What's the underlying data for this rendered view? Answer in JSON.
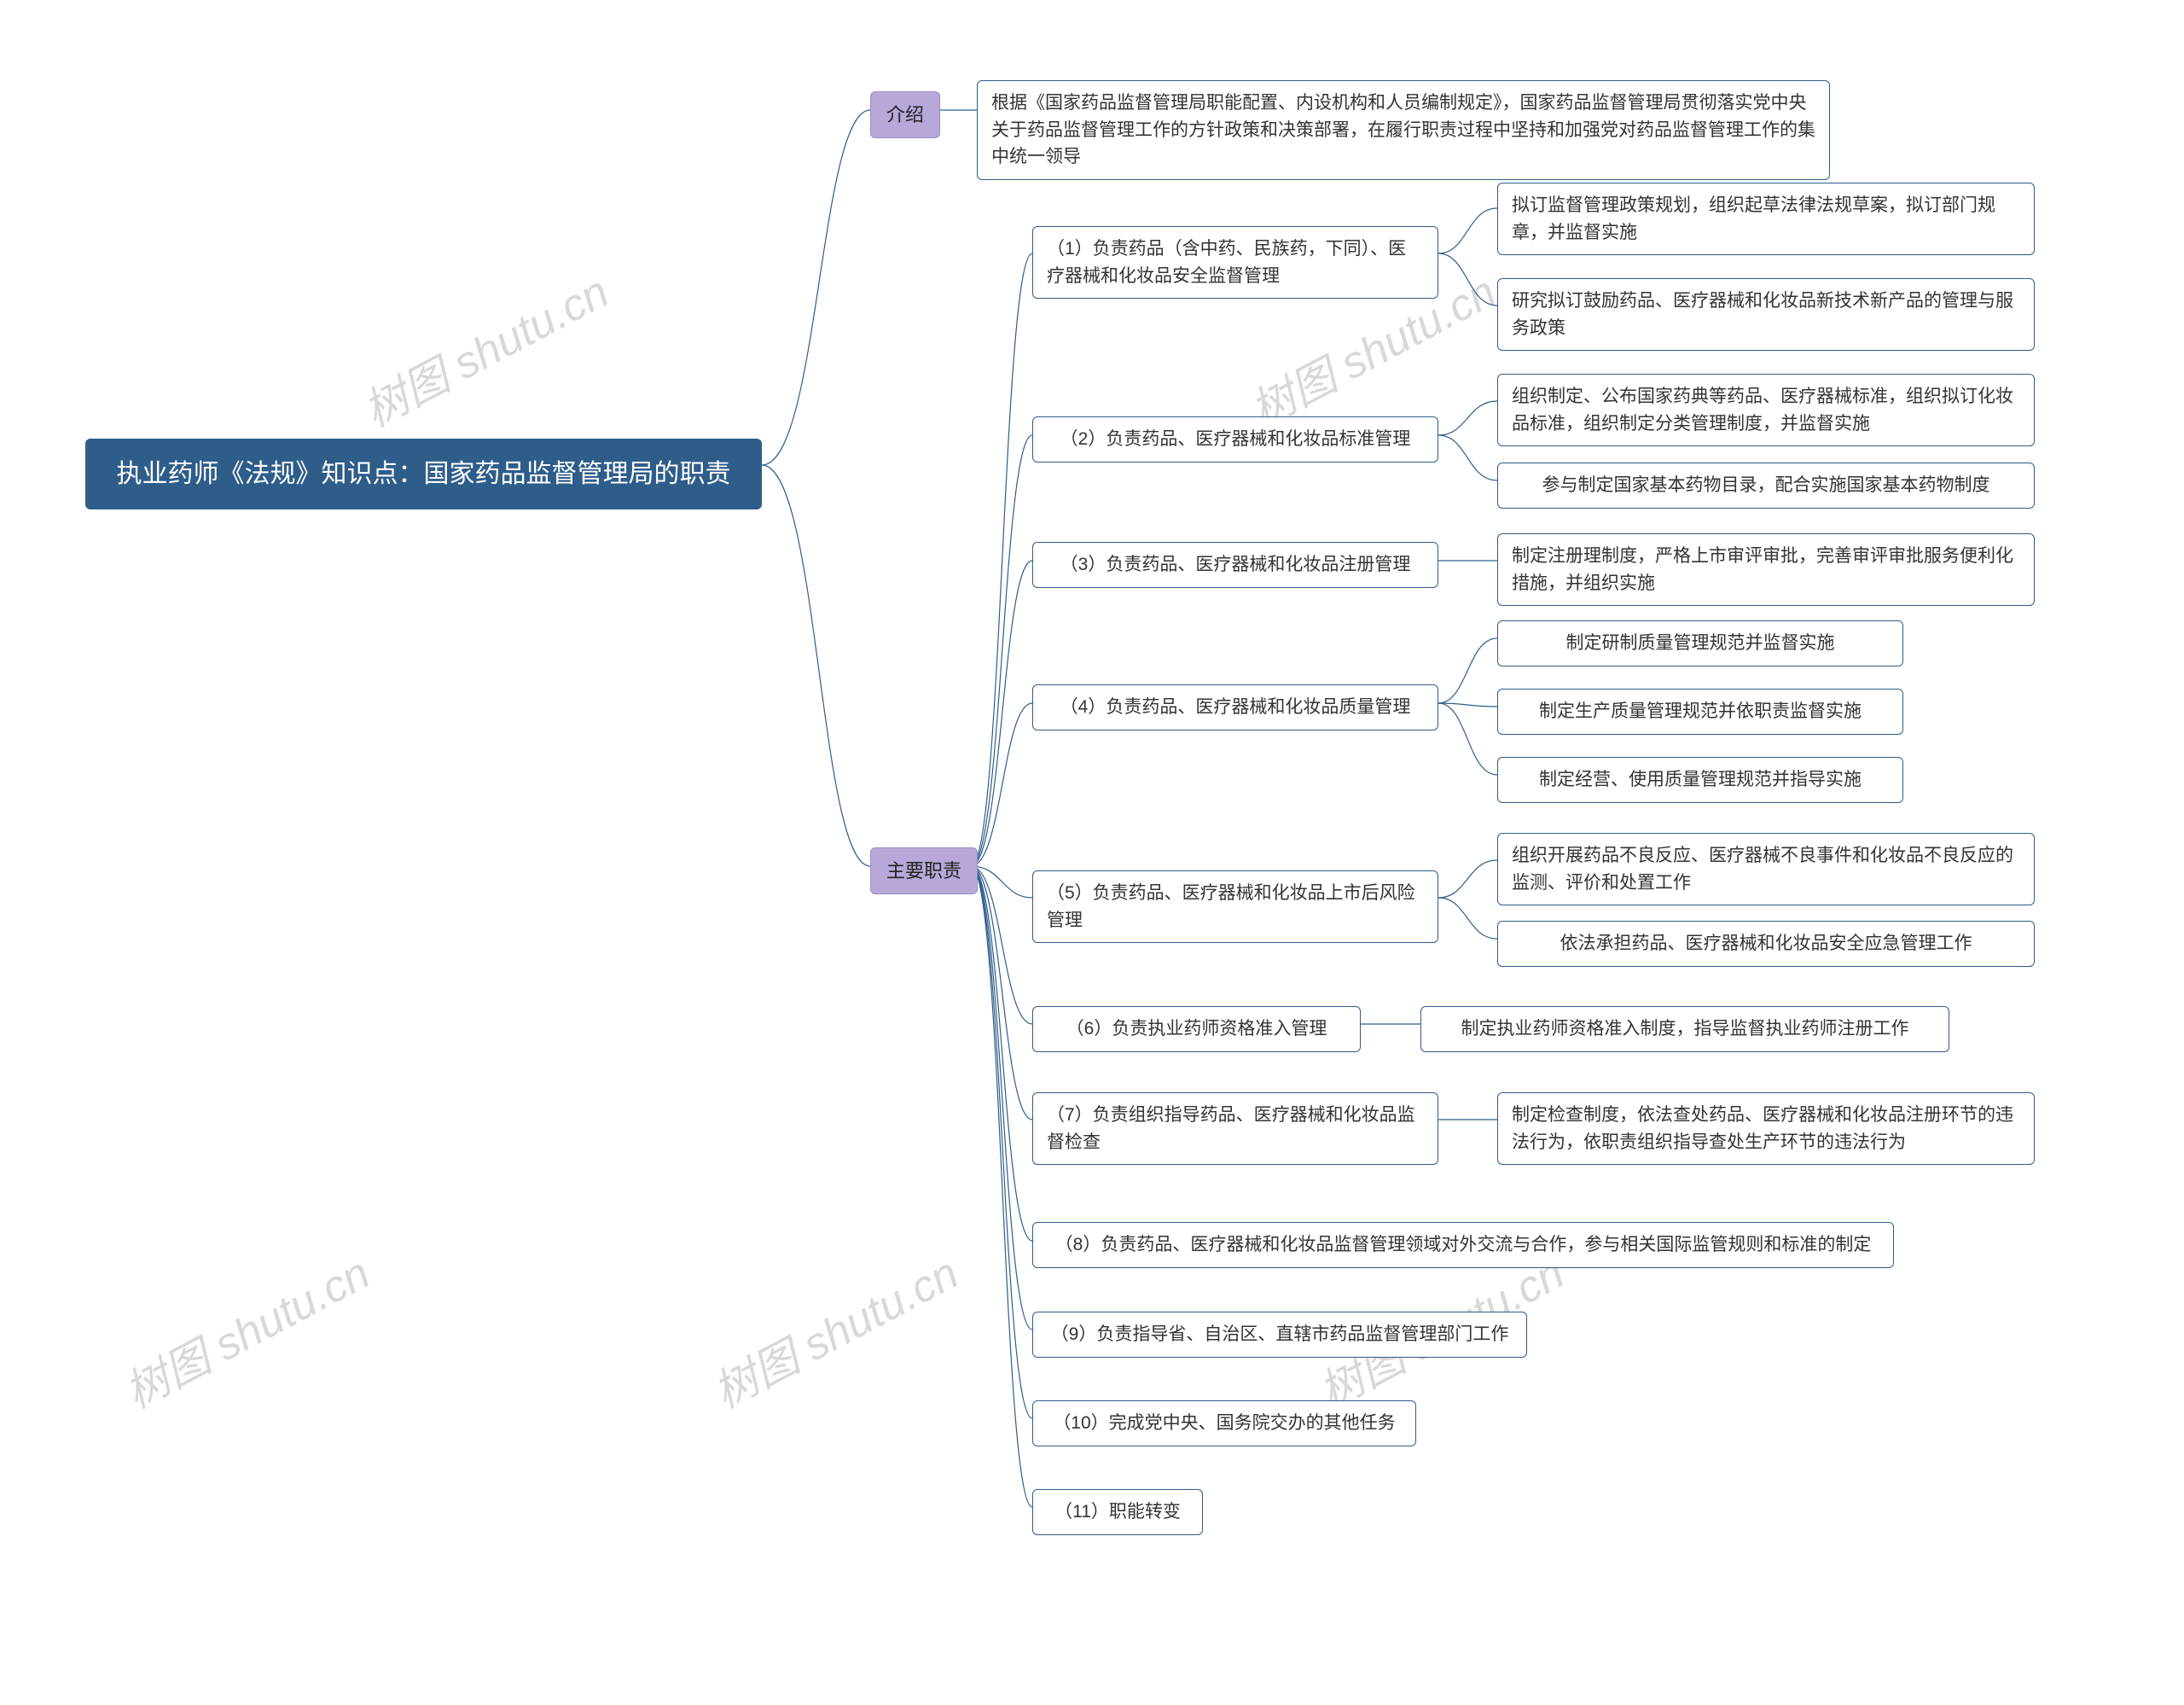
{
  "root": {
    "title": "执业药师《法规》知识点：国家药品监督管理局的职责"
  },
  "intro": {
    "label": "介绍",
    "text": "根据《国家药品监督管理局职能配置、内设机构和人员编制规定》，国家药品监督管理局贯彻落实党中央关于药品监督管理工作的方针政策和决策部署，在履行职责过程中坚持和加强党对药品监督管理工作的集中统一领导"
  },
  "main": {
    "label": "主要职责",
    "items": {
      "d1": {
        "label": "（1）负责药品（含中药、民族药，下同）、医疗器械和化妆品安全监督管理",
        "children": {
          "a": "拟订监督管理政策规划，组织起草法律法规草案，拟订部门规章，并监督实施",
          "b": "研究拟订鼓励药品、医疗器械和化妆品新技术新产品的管理与服务政策"
        }
      },
      "d2": {
        "label": "（2）负责药品、医疗器械和化妆品标准管理",
        "children": {
          "a": "组织制定、公布国家药典等药品、医疗器械标准，组织拟订化妆品标准，组织制定分类管理制度，并监督实施",
          "b": "参与制定国家基本药物目录，配合实施国家基本药物制度"
        }
      },
      "d3": {
        "label": "（3）负责药品、医疗器械和化妆品注册管理",
        "children": {
          "a": "制定注册理制度，严格上市审评审批，完善审评审批服务便利化措施，并组织实施"
        }
      },
      "d4": {
        "label": "（4）负责药品、医疗器械和化妆品质量管理",
        "children": {
          "a": "制定研制质量管理规范并监督实施",
          "b": "制定生产质量管理规范并依职责监督实施",
          "c": "制定经营、使用质量管理规范并指导实施"
        }
      },
      "d5": {
        "label": "（5）负责药品、医疗器械和化妆品上市后风险管理",
        "children": {
          "a": "组织开展药品不良反应、医疗器械不良事件和化妆品不良反应的监测、评价和处置工作",
          "b": "依法承担药品、医疗器械和化妆品安全应急管理工作"
        }
      },
      "d6": {
        "label": "（6）负责执业药师资格准入管理",
        "children": {
          "a": "制定执业药师资格准入制度，指导监督执业药师注册工作"
        }
      },
      "d7": {
        "label": "（7）负责组织指导药品、医疗器械和化妆品监督检查",
        "children": {
          "a": "制定检查制度，依法查处药品、医疗器械和化妆品注册环节的违法行为，依职责组织指导查处生产环节的违法行为"
        }
      },
      "d8": {
        "label": "（8）负责药品、医疗器械和化妆品监督管理领域对外交流与合作，参与相关国际监管规则和标准的制定"
      },
      "d9": {
        "label": "（9）负责指导省、自治区、直辖市药品监督管理部门工作"
      },
      "d10": {
        "label": "（10）完成党中央、国务院交办的其他任务"
      },
      "d11": {
        "label": "（11）职能转变"
      }
    }
  },
  "watermark": "树图 shutu.cn"
}
